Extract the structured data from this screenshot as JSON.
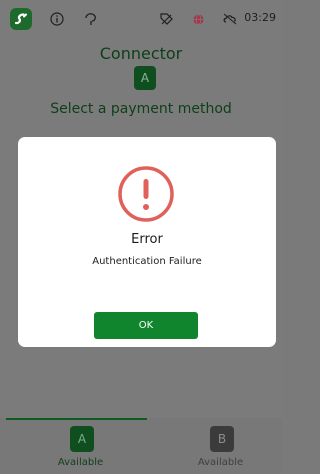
{
  "status_bar": {
    "time": "03:29",
    "icons": [
      "app-logo-icon",
      "info-icon",
      "signal-icon",
      "tag-icon",
      "globe-icon",
      "cloud-icon"
    ]
  },
  "header": {
    "title": "Connector",
    "connector_letter": "A",
    "subtitle": "Select a payment method"
  },
  "dialog": {
    "icon": "error-icon",
    "title": "Error",
    "message": "Authentication Failure",
    "ok_label": "OK"
  },
  "tabs": [
    {
      "letter": "A",
      "status": "Available",
      "selected": true
    },
    {
      "letter": "B",
      "status": "Available",
      "selected": false
    }
  ],
  "colors": {
    "brand_green": "#11852d",
    "dark_green": "#0f4f1f",
    "error_red": "#e0605a",
    "overlay_gray": "#7b7b7b"
  }
}
